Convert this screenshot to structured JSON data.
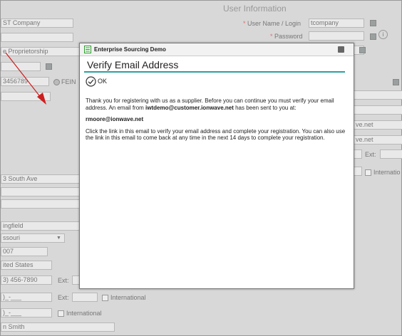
{
  "background": {
    "section_title": "User Information",
    "left": {
      "company_name": "ST Company",
      "legal_structure": "e Proprietorship",
      "tax_id": "3456789",
      "fein_label": "FEIN",
      "address1": "3 South Ave",
      "city": "ingfield",
      "state": "ssouri",
      "zip": "007",
      "country": "ited States",
      "phone": "3) 456-7890",
      "phone_ext_label": "Ext:",
      "fax": ")_-___",
      "fax_ext_label": "Ext:",
      "fax_intl_label": "International",
      "mobile": ")_-___",
      "mobile_intl_label": "International",
      "contact_name": "n Smith"
    },
    "right": {
      "username_label": "User Name / Login",
      "username_value": "tcompany",
      "password_label": "Password",
      "email1_partial": "ve.net",
      "email2_partial": "ve.net",
      "ext_label": "Ext:",
      "intl_label": "Internatio"
    }
  },
  "modal": {
    "window_title": "Enterprise Sourcing Demo",
    "heading": "Verify Email Address",
    "ok_label": "OK",
    "para1_a": "Thank you for registering with us as a supplier. Before you can continue you must verify your email address. An email from ",
    "para1_email": "iwtdemo@customer.ionwave.net",
    "para1_b": " has been sent to you at:",
    "recipient_email": "rmoore@ionwave.net",
    "para2": "Click the link in this email to verify your email address and complete your registration. You can also use the link in this email to come back at any time in the next 14 days to complete your registration."
  },
  "colors": {
    "accent": "#2aa0a0",
    "required": "#e07070",
    "arrow": "#cc1e1e"
  }
}
